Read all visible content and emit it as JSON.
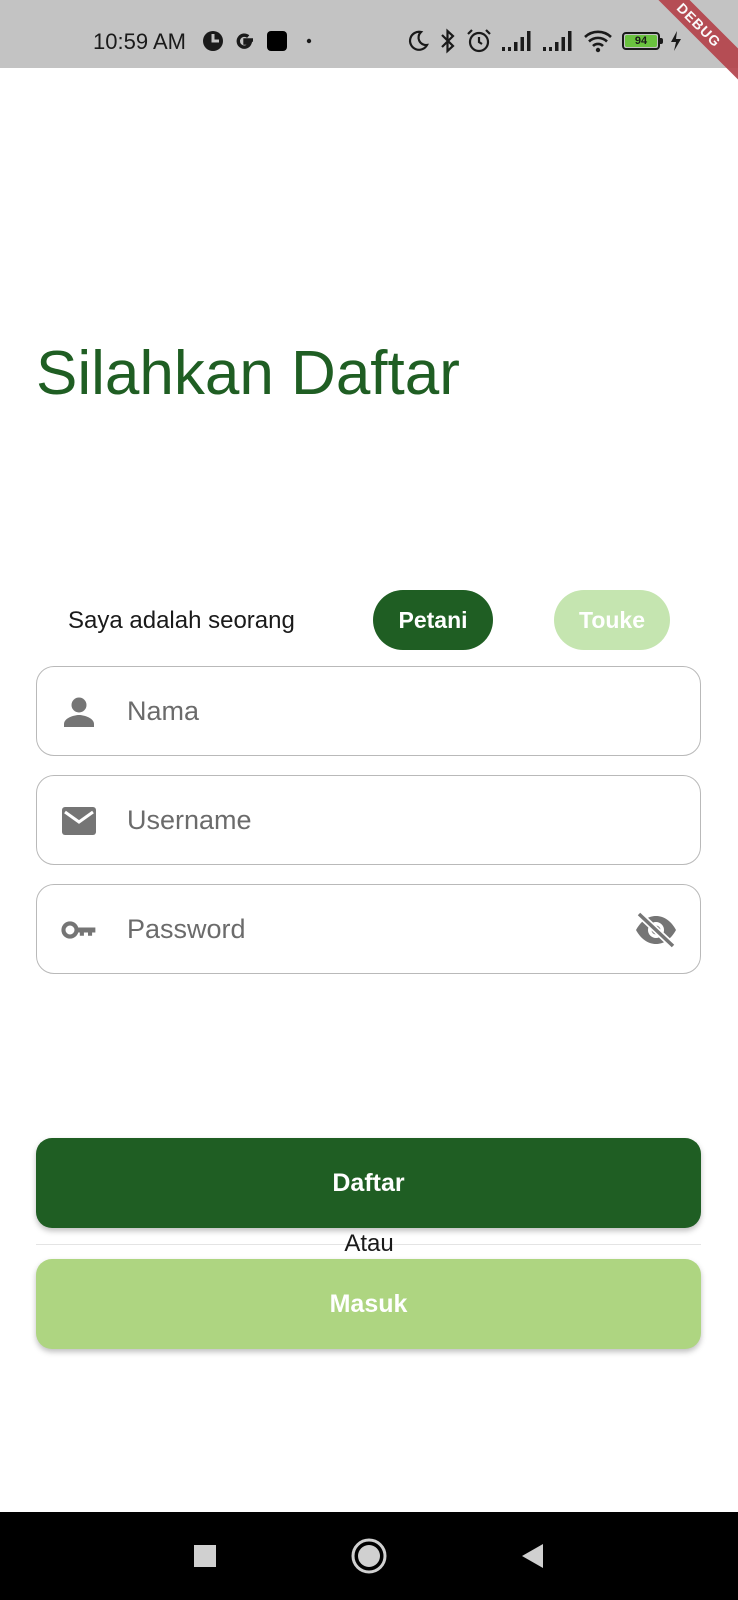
{
  "status_bar": {
    "time": "10:59 AM",
    "battery_level": "94",
    "debug_label": "DEBUG",
    "icons": [
      "clock-app-icon",
      "google-icon",
      "app-square-icon",
      "dot-icon",
      "moon-icon",
      "bluetooth-icon",
      "alarm-icon",
      "signal-icon",
      "signal-icon",
      "wifi-icon",
      "battery-icon",
      "charging-icon"
    ]
  },
  "page": {
    "title": "Silahkan Daftar"
  },
  "role_selector": {
    "label": "Saya adalah seorang",
    "options": [
      {
        "label": "Petani",
        "selected": true
      },
      {
        "label": "Touke",
        "selected": false
      }
    ]
  },
  "form": {
    "name_placeholder": "Nama",
    "username_placeholder": "Username",
    "password_placeholder": "Password"
  },
  "actions": {
    "register_label": "Daftar",
    "divider_text": "Atau",
    "login_label": "Masuk"
  },
  "colors": {
    "primary": "#1f5e23",
    "primary_light": "#aed581",
    "pill_inactive": "#c5e5b0",
    "icon_grey": "#757575"
  },
  "nav_bar": {
    "icons": [
      "recents-square-icon",
      "home-circle-icon",
      "back-triangle-icon"
    ]
  }
}
